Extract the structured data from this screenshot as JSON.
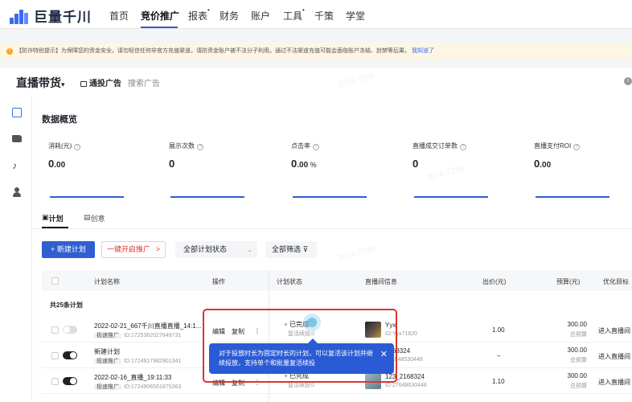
{
  "nav": {
    "logo_text": "巨量千川",
    "items": [
      {
        "label": "首页",
        "sup": ""
      },
      {
        "label": "竞价推广",
        "sup": ""
      },
      {
        "label": "报表",
        "sup": "•"
      },
      {
        "label": "财务",
        "sup": ""
      },
      {
        "label": "账户",
        "sup": ""
      },
      {
        "label": "工具",
        "sup": "•"
      },
      {
        "label": "千策",
        "sup": ""
      },
      {
        "label": "学堂",
        "sup": ""
      }
    ],
    "active_index": 1
  },
  "banner": {
    "text": "【防诈特别提示】为保障您的资金安全，请勿轻信任何非官方充值渠道，请防资金账户被不法分子利用。通过不法渠道充值可能会面临账户冻结、封禁等后果。",
    "link": "我知道了"
  },
  "subheader": {
    "title": "直播带货",
    "caret": "▾",
    "tab_active": "通投广告",
    "tab_other": "搜索广告"
  },
  "overview": {
    "title": "数据概览",
    "metrics": [
      {
        "label": "消耗(元)",
        "value_int": "0",
        "value_dec": ".00",
        "unit": ""
      },
      {
        "label": "展示次数",
        "value_int": "0",
        "value_dec": "",
        "unit": ""
      },
      {
        "label": "点击率",
        "value_int": "0",
        "value_dec": ".00",
        "unit": " %"
      },
      {
        "label": "直播成交订单数",
        "value_int": "0",
        "value_dec": "",
        "unit": ""
      },
      {
        "label": "直播支付ROI",
        "value_int": "0",
        "value_dec": ".00",
        "unit": ""
      }
    ]
  },
  "tabs": {
    "plan": "计划",
    "creative": "创意"
  },
  "toolbar": {
    "new_plan": "+ 新建计划",
    "one_click": "一键开启推广",
    "one_click_chev": ">",
    "status_select": "全部计划状态",
    "filter": "全部筛选"
  },
  "table": {
    "headers": {
      "name": "计划名称",
      "ops": "操作",
      "status": "计划状态",
      "live": "直播间信息",
      "bid": "出价(元)",
      "budget": "预算(元)",
      "goal": "优化目标"
    },
    "count_text": "共25条计划",
    "rows": [
      {
        "name": "2022-02-21_667千川直播直播_14:1...",
        "tag": "极速推广",
        "id": "ID:1725362027849731",
        "toggle": "off",
        "edit": "编辑",
        "copy": "复制",
        "more": "⋮",
        "status": "已完成",
        "status_sub": "复活续投⊙",
        "live_name": "Yyx",
        "live_id": "ID:Yyx71620",
        "bid": "1.00",
        "budget": "300.00",
        "budget_type": "总预算",
        "goal": "进入直播间"
      },
      {
        "name": "新建计划",
        "tag": "极速推广",
        "id": "ID:1724917982901341",
        "toggle": "on",
        "edit": "",
        "copy": "",
        "more": "",
        "status": "",
        "status_sub": "",
        "live_name": "2168324",
        "live_id": "648548530448",
        "bid": "–",
        "budget": "300.00",
        "budget_type": "总预算",
        "goal": "进入直播间"
      },
      {
        "name": "2022-02-16_直播_19:11:33",
        "tag": "极速推广",
        "id": "ID:1724906561875363",
        "toggle": "on",
        "edit": "编辑",
        "copy": "复制",
        "more": "⋮",
        "status": "已完成",
        "status_sub": "复活续投⊙",
        "live_name": "123_2168324",
        "live_id": "ID:27648630448",
        "bid": "1.10",
        "budget": "300.00",
        "budget_type": "总预算",
        "goal": "进入直播间"
      }
    ]
  },
  "tooltip": {
    "text": "对于投放时长为固定时长的计划，可以复活该计划并继续投放，支持单个和批量复活续投",
    "close": "✕"
  }
}
